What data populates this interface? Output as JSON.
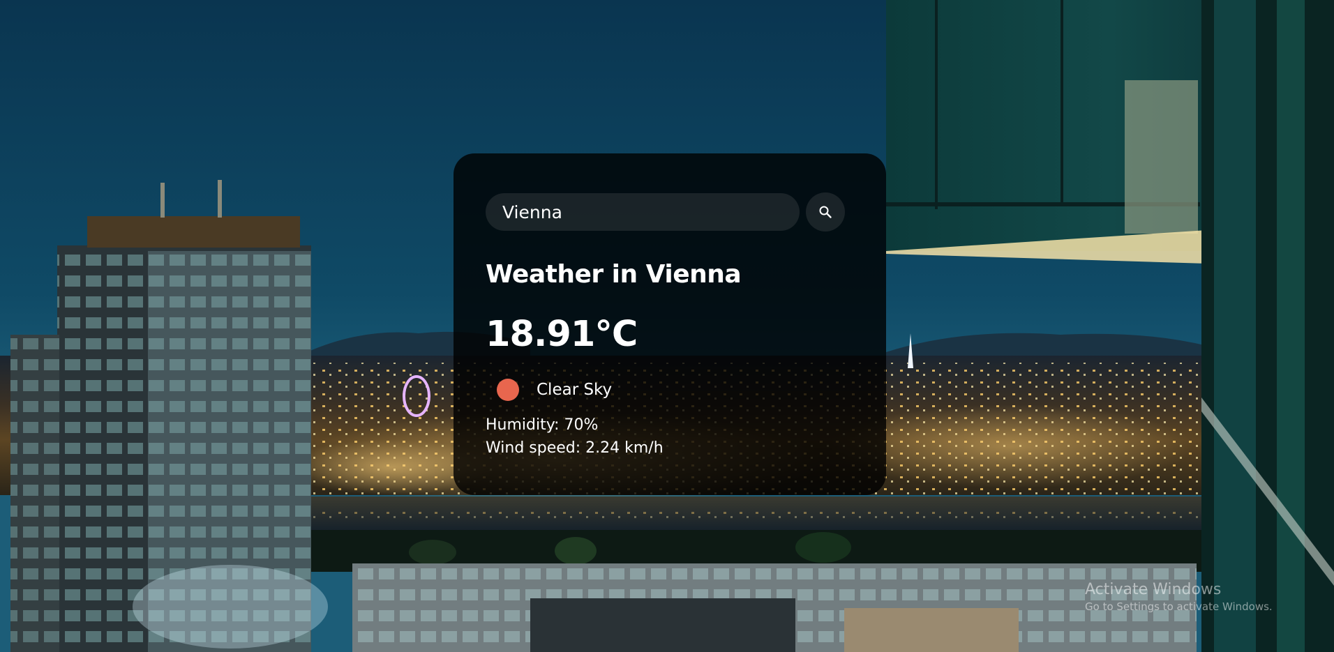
{
  "search": {
    "value": "Vienna"
  },
  "weather": {
    "city_heading": "Weather in Vienna",
    "temperature": "18.91°C",
    "description": "Clear Sky",
    "humidity": "Humidity: 70%",
    "wind": "Wind speed: 2.24 km/h"
  },
  "icons": {
    "search": "search-icon",
    "weather": "clear-sky-sun-icon"
  },
  "colors": {
    "sky": "#0c3f56",
    "card_overlay": "#000000",
    "text": "#ffffff",
    "weather_icon": "#e8664e",
    "watermark": "#9aa7b0"
  },
  "watermark": {
    "title": "Activate Windows",
    "subtitle": "Go to Settings to activate Windows."
  }
}
